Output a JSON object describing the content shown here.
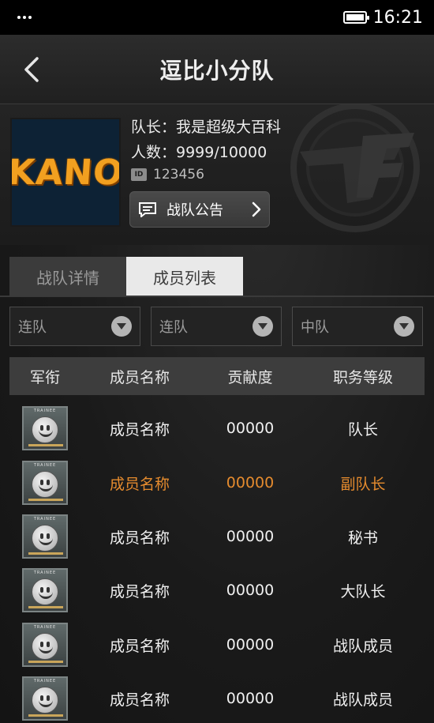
{
  "status_bar": {
    "time": "16:21",
    "menu_icon": "three-dots-icon",
    "battery_icon": "battery-icon"
  },
  "header": {
    "title": "逗比小分队",
    "back_icon": "chevron-left-icon"
  },
  "team": {
    "logo_text": "KANO",
    "captain": "队长：我是超级大百科",
    "members": "人数：9999/10000",
    "id_badge": "ID",
    "id": "123456",
    "notice_label": "战队公告",
    "emblem": "cf-emblem"
  },
  "tabs": [
    {
      "label": "战队详情",
      "active": false
    },
    {
      "label": "成员列表",
      "active": true
    }
  ],
  "filters": [
    {
      "label": "连队"
    },
    {
      "label": "连队"
    },
    {
      "label": "中队"
    }
  ],
  "table": {
    "headers": [
      "军衔",
      "成员名称",
      "贡献度",
      "职务等级"
    ],
    "rank_badge_text": "TRAINEE",
    "rows": [
      {
        "name": "成员名称",
        "contribution": "00000",
        "role": "队长",
        "highlight": false
      },
      {
        "name": "成员名称",
        "contribution": "00000",
        "role": "副队长",
        "highlight": true
      },
      {
        "name": "成员名称",
        "contribution": "00000",
        "role": "秘书",
        "highlight": false
      },
      {
        "name": "成员名称",
        "contribution": "00000",
        "role": "大队长",
        "highlight": false
      },
      {
        "name": "成员名称",
        "contribution": "00000",
        "role": "战队成员",
        "highlight": false
      },
      {
        "name": "成员名称",
        "contribution": "00000",
        "role": "战队成员",
        "highlight": false
      }
    ]
  },
  "colors": {
    "highlight": "#e58b2e",
    "logo_text": "#f2a020",
    "logo_bg": "#0d2235"
  }
}
